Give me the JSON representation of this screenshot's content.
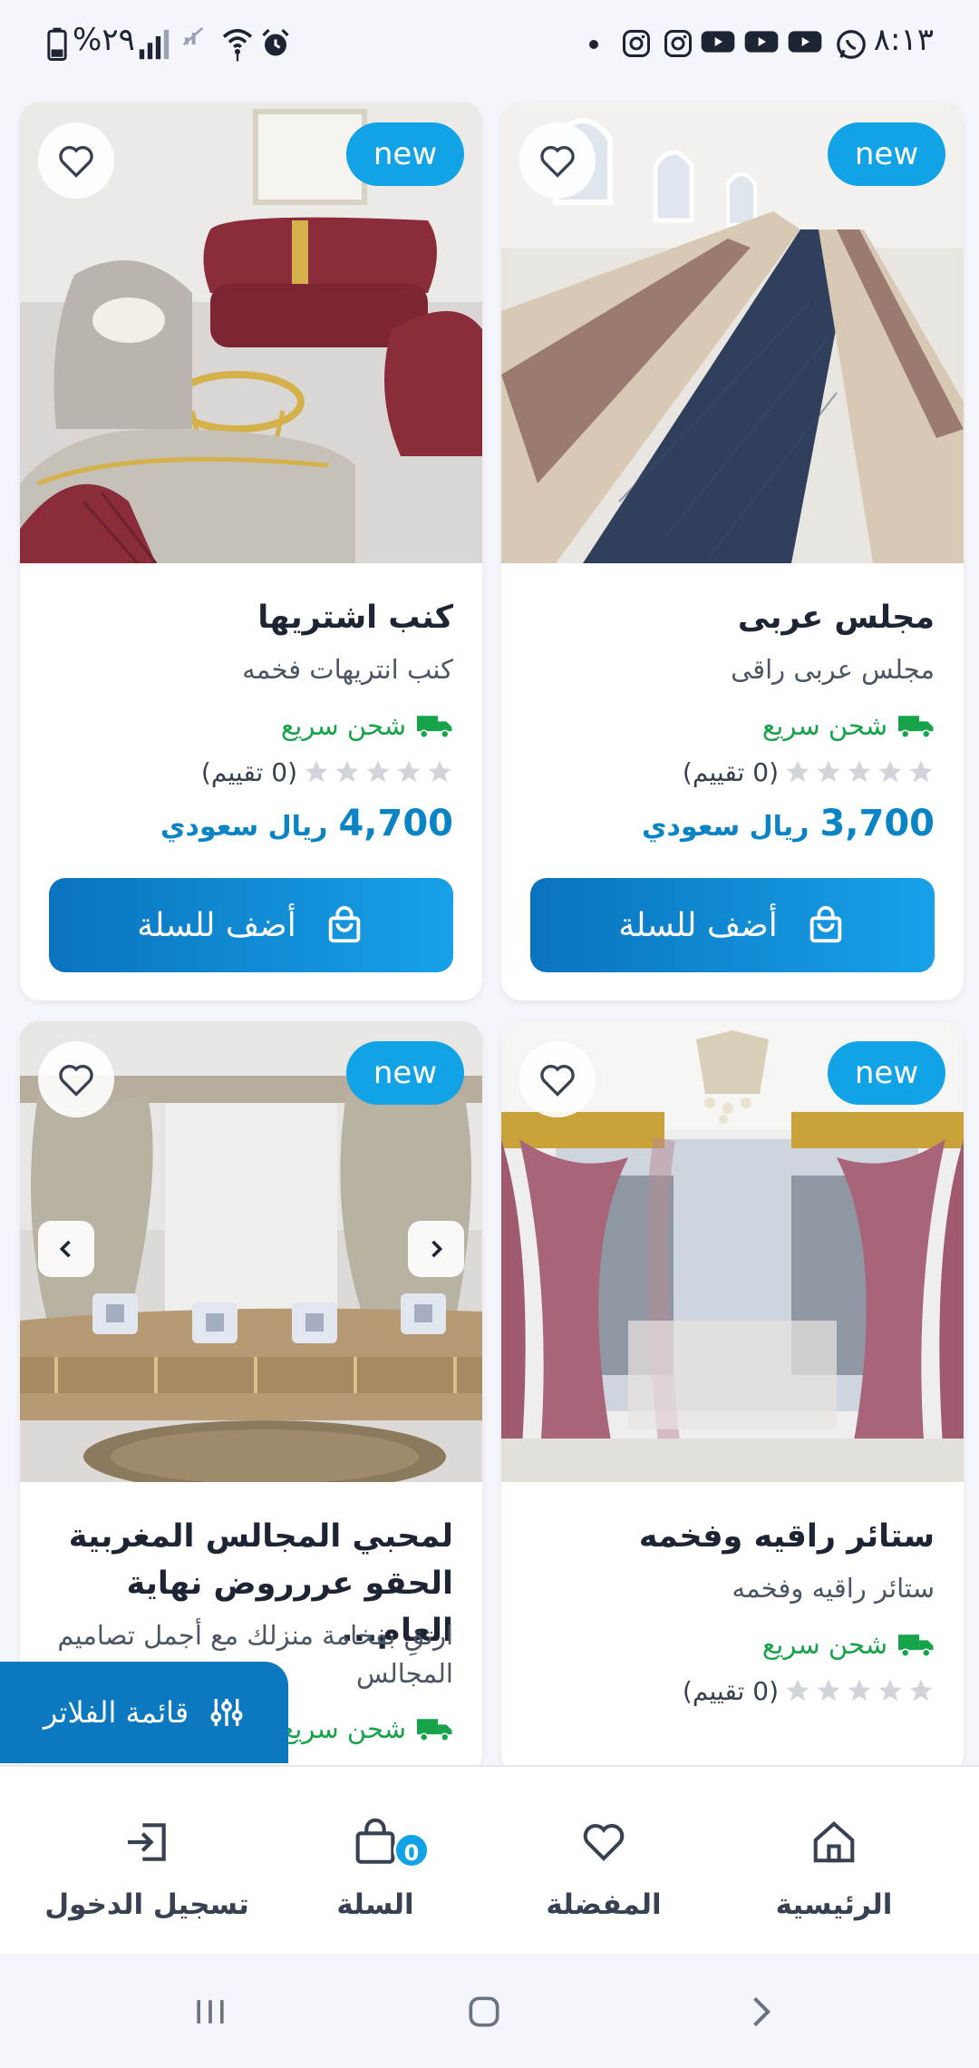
{
  "status_bar": {
    "time": "٨:١٣",
    "battery": "%٢٩"
  },
  "products": [
    {
      "badge": "new",
      "title": "مجلس عربى",
      "description": "مجلس عربى راقى",
      "shipping": "شحن سريع",
      "rating_text": "(0 تقييم)",
      "rating": 0,
      "price": "3,700",
      "currency": "ريال سعودي",
      "add_to_cart": "أضف للسلة"
    },
    {
      "badge": "new",
      "title": "كنب اشتريها",
      "description": "كنب انتريهات فخمه",
      "shipping": "شحن سريع",
      "rating_text": "(0 تقييم)",
      "rating": 0,
      "price": "4,700",
      "currency": "ريال سعودي",
      "add_to_cart": "أضف للسلة"
    },
    {
      "badge": "new",
      "title": "ستائر راقيه وفخمه",
      "description": "ستائر راقيه وفخمه",
      "shipping": "شحن سريع",
      "rating_text": "(0 تقييم)",
      "rating": 0
    },
    {
      "badge": "new",
      "title": "لمحبي المجالس المغربية الحقو عررروض نهاية العام...",
      "description": "ارتقِ بفخامة منزلك مع أجمل تصاميم المجالس",
      "shipping": "شحن سريع"
    }
  ],
  "filter_button": "قائمة الفلاتر",
  "bottom_nav": {
    "home": "الرئيسية",
    "favorites": "المفضلة",
    "cart": "السلة",
    "cart_count": "0",
    "login": "تسجيل الدخول"
  },
  "colors": {
    "accent": "#12a3e6",
    "primary": "#0b78c0",
    "price": "#0b84c6",
    "shipping": "#16a34a"
  },
  "icons": [
    "battery-icon",
    "signal-icon",
    "wifi-icon",
    "alarm-icon",
    "instagram-icon",
    "youtube-icon",
    "whatsapp-icon",
    "heart-icon",
    "truck-icon",
    "star-icon",
    "bag-icon",
    "filter-sliders-icon",
    "home-icon",
    "login-icon",
    "chevron-left-icon",
    "chevron-right-icon",
    "recents-icon",
    "home-nav-icon",
    "back-icon"
  ]
}
